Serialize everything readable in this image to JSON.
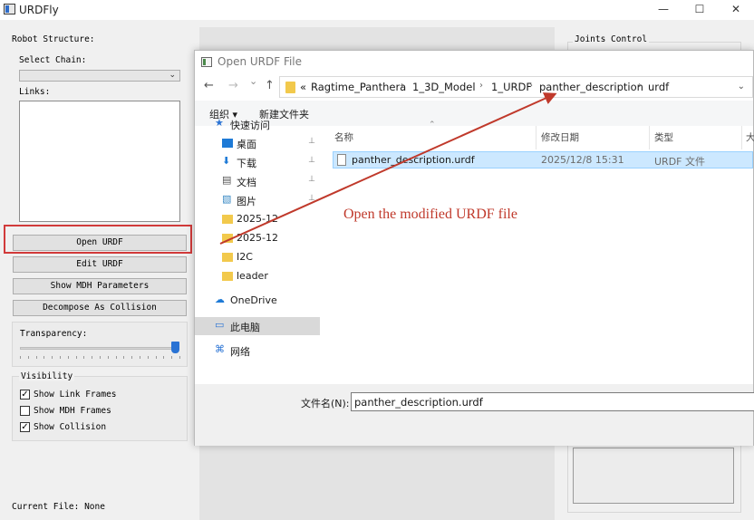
{
  "app": {
    "title": "URDFly",
    "window_controls": {
      "minimize": "—",
      "maximize": "☐",
      "close": "✕"
    }
  },
  "left_panel": {
    "robot_structure_label": "Robot Structure:",
    "select_chain_label": "Select Chain:",
    "select_chain_value": "",
    "links_label": "Links:",
    "buttons": {
      "open_urdf": "Open URDF",
      "edit_urdf": "Edit URDF",
      "show_mdh": "Show MDH Parameters",
      "decompose": "Decompose As Collision"
    },
    "transparency_label": "Transparency:",
    "transparency_value": 1.0,
    "visibility_label": "Visibility",
    "checkboxes": [
      {
        "label": "Show Link Frames",
        "checked": true
      },
      {
        "label": "Show MDH Frames",
        "checked": false
      },
      {
        "label": "Show Collision",
        "checked": true
      }
    ],
    "current_file": "Current File: None"
  },
  "right_panel": {
    "joints_control_label": "Joints Control"
  },
  "dialog": {
    "title": "Open URDF File",
    "nav": {
      "back": "←",
      "forward": "→",
      "dropdown": "⌄",
      "up": "↑"
    },
    "breadcrumb_prefix": "«",
    "breadcrumb": [
      "Ragtime_Panthera",
      "1_3D_Model",
      "1_URDF",
      "panther_description",
      "urdf"
    ],
    "breadcrumb_sep": "›",
    "command_bar": {
      "organize": "组织 ▾",
      "new_folder": "新建文件夹"
    },
    "nav_pane": [
      {
        "label": "快速访问",
        "icon": "star-icon",
        "pinned": false
      },
      {
        "label": "桌面",
        "icon": "desktop-icon",
        "pinned": true
      },
      {
        "label": "下载",
        "icon": "download-icon",
        "pinned": true
      },
      {
        "label": "文档",
        "icon": "document-icon",
        "pinned": true
      },
      {
        "label": "图片",
        "icon": "pictures-icon",
        "pinned": true
      },
      {
        "label": "2025-12",
        "icon": "folder-icon",
        "pinned": false
      },
      {
        "label": "2025-12",
        "icon": "folder-icon",
        "pinned": false
      },
      {
        "label": "I2C",
        "icon": "folder-icon",
        "pinned": false
      },
      {
        "label": "leader",
        "icon": "folder-icon",
        "pinned": false
      },
      {
        "label": "OneDrive",
        "icon": "cloud-icon",
        "pinned": false
      },
      {
        "label": "此电脑",
        "icon": "pc-icon",
        "pinned": false,
        "selected": true
      },
      {
        "label": "网络",
        "icon": "network-icon",
        "pinned": false
      }
    ],
    "pin_glyph": "📌",
    "columns": {
      "name": "名称",
      "modified": "修改日期",
      "type": "类型",
      "size": "大"
    },
    "files": [
      {
        "name": "panther_description.urdf",
        "modified": "2025/12/8 15:31",
        "type": "URDF 文件"
      }
    ],
    "filename_label": "文件名(N):",
    "filename_value": "panther_description.urdf"
  },
  "annotation": {
    "text": "Open the modified URDF file",
    "color": "#c0392b"
  },
  "colors": {
    "highlight_box": "#d13a3a",
    "selection_bg": "#cce8ff",
    "slider_accent": "#2a73d4"
  }
}
